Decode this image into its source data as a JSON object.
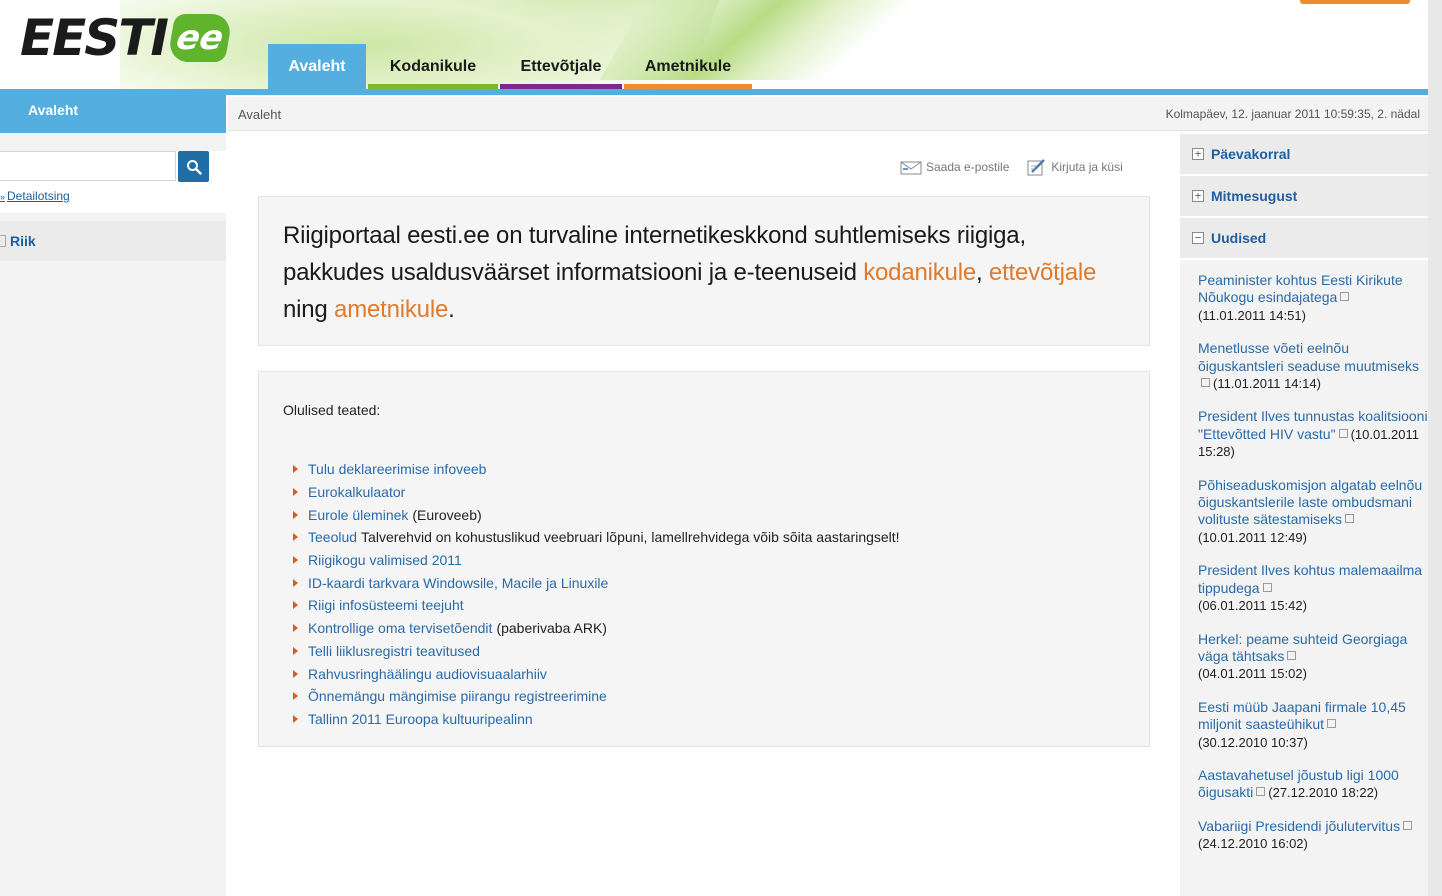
{
  "logo": {
    "text": "EESTI",
    "badge": "ee"
  },
  "nav": {
    "tabs": [
      {
        "label": "Avaleht",
        "color": "#54aee0"
      },
      {
        "label": "Kodanikule",
        "color": "#7ab92c"
      },
      {
        "label": "Ettevõtjale",
        "color": "#7a2a8c"
      },
      {
        "label": "Ametnikule",
        "color": "#f08c2e"
      }
    ]
  },
  "left": {
    "header": "Avaleht",
    "search": {
      "value": "",
      "placeholder": ""
    },
    "detail_link": "Detailotsing",
    "riik": "Riik"
  },
  "breadcrumb": "Avaleht",
  "datetime": "Kolmapäev, 12. jaanuar 2011 10:59:35, 2. nädal",
  "tools": {
    "email": "Saada e-postile",
    "ask": "Kirjuta ja küsi"
  },
  "intro": {
    "text1": "Riigiportaal eesti.ee on turvaline internetikeskkond suhtlemiseks riigiga, pakkudes usaldusväärset informatsiooni ja e-teenuseid ",
    "link1": "kodanikule",
    "sep1": ", ",
    "link2": "ettevõtjale",
    "sep2": " ning ",
    "link3": "ametnikule",
    "end": "."
  },
  "notices": {
    "title": "Olulised teated:",
    "items": [
      {
        "link": "Tulu deklareerimise infoveeb",
        "extra": ""
      },
      {
        "link": "Eurokalkulaator",
        "extra": ""
      },
      {
        "link": "Eurole üleminek",
        "extra": "(Euroveeb)"
      },
      {
        "link": "Teeolud",
        "extra": "Talverehvid on kohustuslikud veebruari lõpuni, lamellrehvidega võib sõita aastaringselt!"
      },
      {
        "link": "Riigikogu valimised 2011",
        "extra": ""
      },
      {
        "link": "ID-kaardi tarkvara Windowsile, Macile ja Linuxile",
        "extra": ""
      },
      {
        "link": "Riigi infosüsteemi teejuht",
        "extra": ""
      },
      {
        "link": "Kontrollige oma tervisetõendit",
        "extra": "(paberivaba ARK)"
      },
      {
        "link": "Telli liiklusregistri teavitused",
        "extra": ""
      },
      {
        "link": "Rahvusringhäälingu audiovisuaalarhiiv",
        "extra": ""
      },
      {
        "link": "Õnnemängu mängimise piirangu registreerimine",
        "extra": ""
      },
      {
        "link": "Tallinn 2011 Euroopa kultuuripealinn",
        "extra": ""
      }
    ]
  },
  "right": {
    "sections": [
      {
        "label": "Päevakorral",
        "state": "+"
      },
      {
        "label": "Mitmesugust",
        "state": "+"
      },
      {
        "label": "Uudised",
        "state": "−"
      }
    ],
    "news": [
      {
        "title": "Peaminister kohtus Eesti Kirikute Nõukogu esindajatega",
        "date": "(11.01.2011 14:51)"
      },
      {
        "title": "Menetlusse võeti eelnõu õiguskantsleri seaduse muutmiseks",
        "date": "(11.01.2011 14:14)"
      },
      {
        "title": "President Ilves tunnustas koalitsiooni \"Ettevõtted HIV vastu\"",
        "date": "(10.01.2011 15:28)"
      },
      {
        "title": "Põhiseaduskomisjon algatab eelnõu õiguskantslerile laste ombudsmani volituste sätestamiseks",
        "date": "(10.01.2011 12:49)"
      },
      {
        "title": "President Ilves kohtus malemaailma tippudega",
        "date": "(06.01.2011 15:42)"
      },
      {
        "title": "Herkel: peame suhteid Georgiaga väga tähtsaks",
        "date": "(04.01.2011 15:02)"
      },
      {
        "title": "Eesti müüb Jaapani firmale 10,45 miljonit saasteühikut",
        "date": "(30.12.2010 10:37)"
      },
      {
        "title": "Aastavahetusel jõustub ligi 1000 õigusakti",
        "date": "(27.12.2010 18:22)"
      },
      {
        "title": "Vabariigi Presidendi jõulutervitus",
        "date": "(24.12.2010 16:02)"
      }
    ]
  }
}
